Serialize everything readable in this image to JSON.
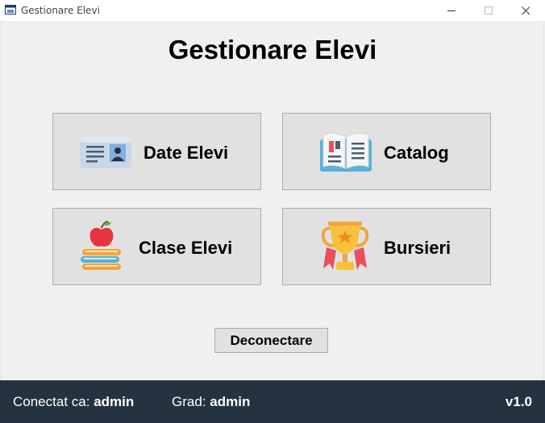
{
  "window": {
    "title": "Gestionare Elevi"
  },
  "header": {
    "title": "Gestionare Elevi"
  },
  "tiles": [
    {
      "label": "Date Elevi",
      "icon": "id-card-icon"
    },
    {
      "label": "Catalog",
      "icon": "open-book-icon"
    },
    {
      "label": "Clase Elevi",
      "icon": "books-apple-icon"
    },
    {
      "label": "Bursieri",
      "icon": "trophy-icon"
    }
  ],
  "actions": {
    "logout_label": "Deconectare"
  },
  "status": {
    "connected_label": "Conectat ca:",
    "connected_user": "admin",
    "role_label": "Grad:",
    "role_value": "admin",
    "version": "v1.0"
  },
  "colors": {
    "statusbar_bg": "#25323f",
    "tile_bg": "#e1e1e1",
    "window_bg": "#f0f0f0"
  }
}
